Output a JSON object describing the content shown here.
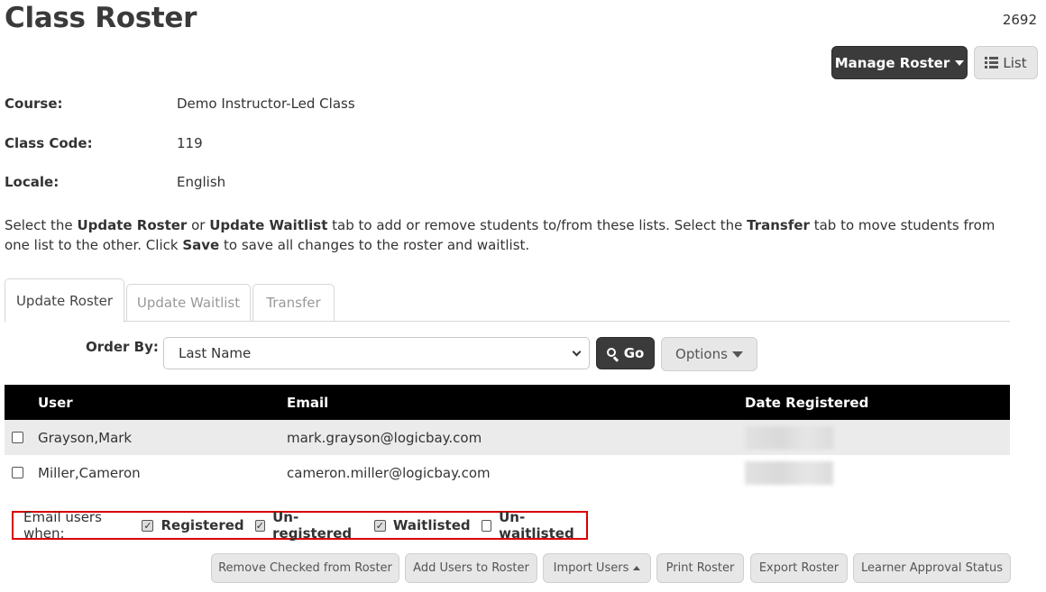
{
  "page": {
    "title": "Class Roster",
    "id": "2692"
  },
  "header_buttons": {
    "manage_roster": "Manage Roster",
    "list": "List"
  },
  "fields": [
    {
      "label": "Course:",
      "value": "Demo Instructor-Led Class"
    },
    {
      "label": "Class Code:",
      "value": "119"
    },
    {
      "label": "Locale:",
      "value": "English"
    }
  ],
  "instructions": {
    "p1": "Select the ",
    "b1": "Update Roster",
    "p2": " or ",
    "b2": "Update Waitlist",
    "p3": " tab to add or remove students to/from these lists. Select the ",
    "b3": "Transfer",
    "p4": " tab to move students from one list to the other. Click ",
    "b4": "Save",
    "p5": " to save all changes to the roster and waitlist."
  },
  "tabs": [
    {
      "label": "Update Roster",
      "active": true
    },
    {
      "label": "Update Waitlist",
      "active": false
    },
    {
      "label": "Transfer",
      "active": false
    }
  ],
  "order_by": {
    "label": "Order By:",
    "selected": "Last Name",
    "go": "Go",
    "options": "Options"
  },
  "table": {
    "columns": [
      "User",
      "Email",
      "Date Registered"
    ],
    "rows": [
      {
        "user": "Grayson,Mark",
        "email": "mark.grayson@logicbay.com"
      },
      {
        "user": "Miller,Cameron",
        "email": "cameron.miller@logicbay.com"
      }
    ]
  },
  "email_users": {
    "label": "Email users when:",
    "options": [
      {
        "label": "Registered",
        "checked": true
      },
      {
        "label": "Un-registered",
        "checked": true
      },
      {
        "label": "Waitlisted",
        "checked": true
      },
      {
        "label": "Un-waitlisted",
        "checked": false
      }
    ]
  },
  "bottom_buttons": {
    "remove_checked": "Remove Checked from Roster",
    "add_users": "Add Users to Roster",
    "import_users": "Import Users",
    "print_roster": "Print Roster",
    "export_roster": "Export Roster",
    "learner_approval": "Learner Approval Status"
  },
  "colors": {
    "highlight_border": "#d90000",
    "dark_button": "#3b3b3b",
    "table_header": "#000000"
  }
}
